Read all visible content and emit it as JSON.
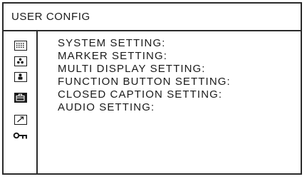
{
  "title": "USER CONFIG",
  "menu_icons": [
    {
      "name": "system-setting-icon"
    },
    {
      "name": "marker-setting-icon"
    },
    {
      "name": "person-icon"
    },
    {
      "name": "briefcase-icon"
    },
    {
      "name": "arrow-icon"
    },
    {
      "name": "key-icon"
    }
  ],
  "items": [
    {
      "label": "SYSTEM SETTING:"
    },
    {
      "label": "MARKER SETTING:"
    },
    {
      "label": "MULTI DISPLAY SETTING:"
    },
    {
      "label": "FUNCTION BUTTON SETTING:"
    },
    {
      "label": "CLOSED CAPTION SETTING:"
    },
    {
      "label": "AUDIO SETTING:"
    }
  ]
}
